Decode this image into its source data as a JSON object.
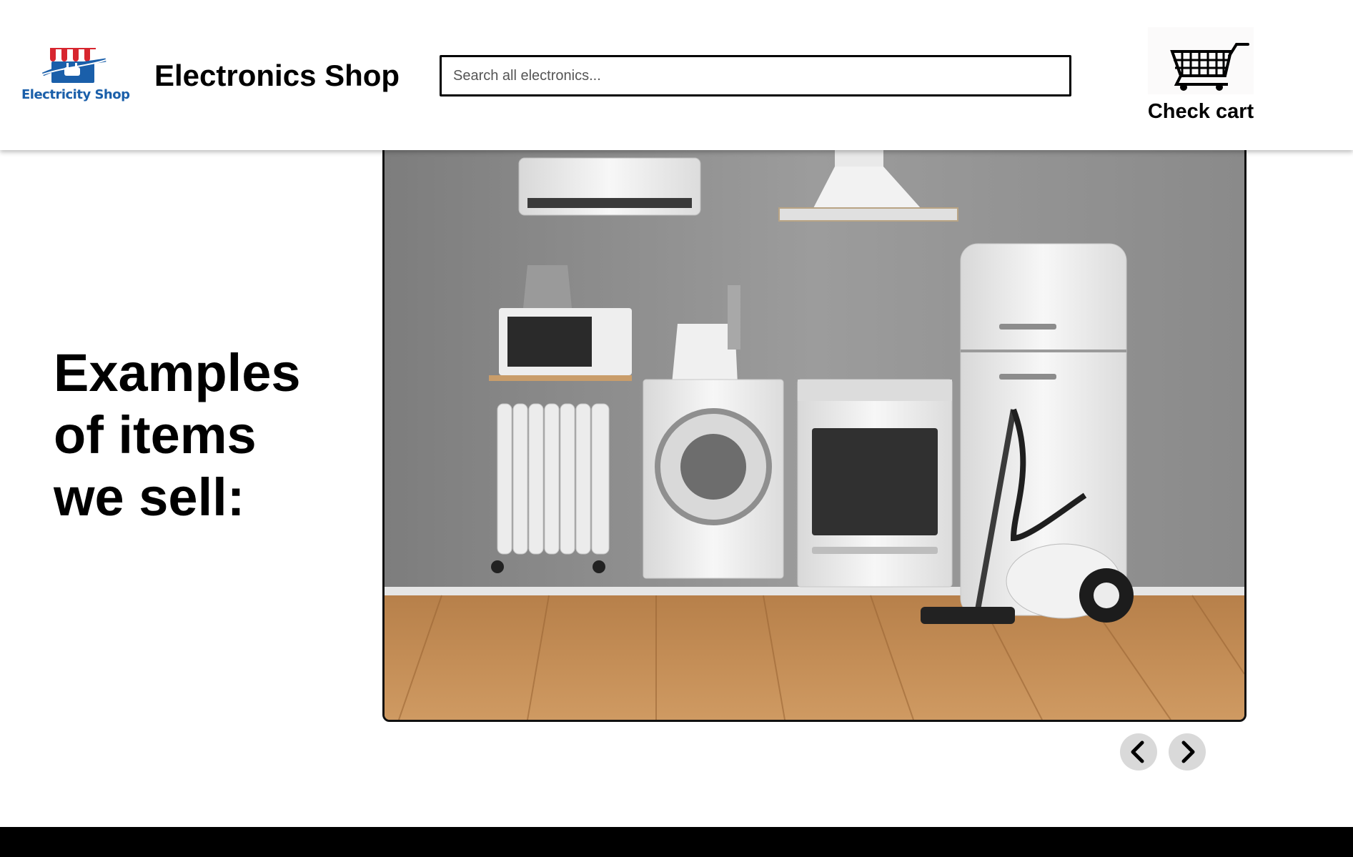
{
  "header": {
    "logo_text": "Electricity Shop",
    "shop_title": "Electronics Shop",
    "search": {
      "placeholder": "Search all electronics...",
      "value": ""
    },
    "cart": {
      "icon": "shopping-cart-icon",
      "label": "Check cart"
    }
  },
  "main": {
    "heading_lines": [
      "Examples",
      "of items",
      "we sell:"
    ],
    "carousel": {
      "image": "home-appliances-photo",
      "prev_icon": "chevron-left-icon",
      "next_icon": "chevron-right-icon"
    }
  },
  "colors": {
    "brand_blue": "#1a5faa",
    "awning_red": "#d7262f",
    "footer": "#000000",
    "nav_button": "#d9d9d9"
  }
}
